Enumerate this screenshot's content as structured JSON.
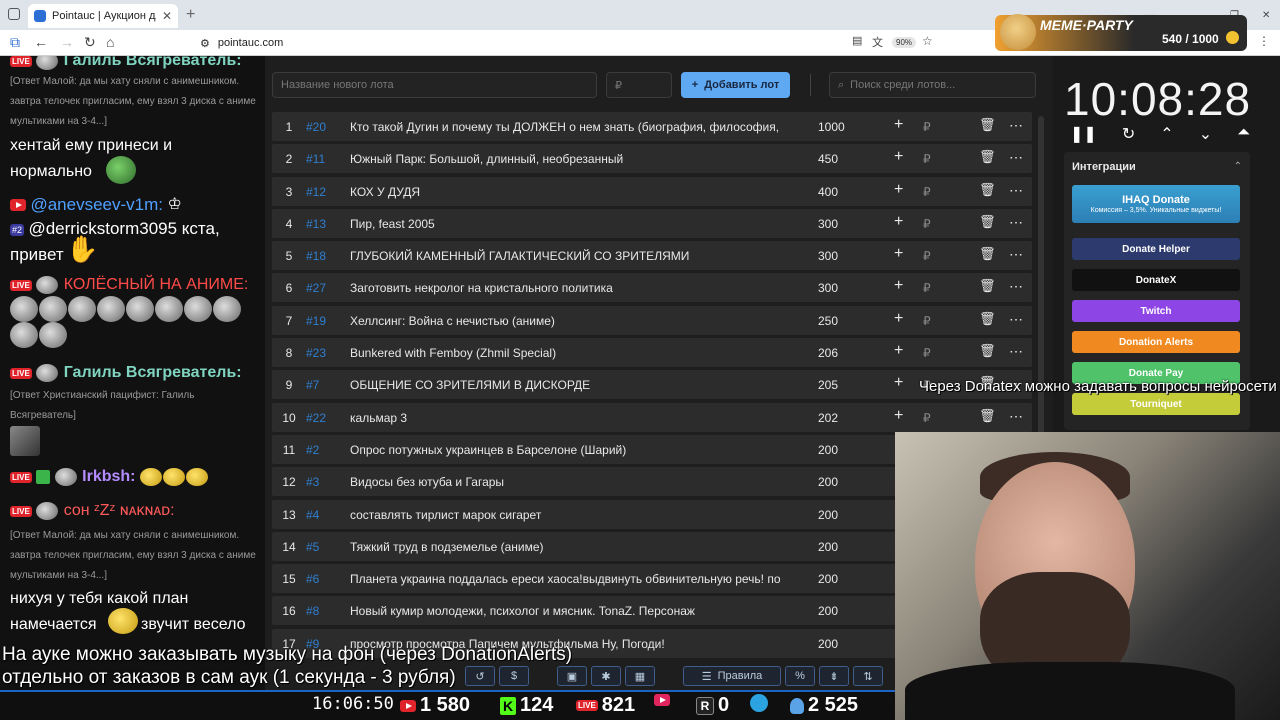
{
  "browser": {
    "tab_title": "Pointauc | Аукцион для стрим…",
    "url": "pointauc.com",
    "zoom": "90%"
  },
  "chat": {
    "messages": [
      {
        "user": "Галиль Всягреватель:",
        "color": "#7fd4c0"
      },
      {
        "quote": "[Ответ Малой: да мы хату сняли с анимешником. завтра телочек пригласим, ему взял 3 диска с аниме мультиками на 3-4...]"
      },
      {
        "text": "хентай ему принеси и нормально"
      },
      {
        "user": "@anevseev-v1m:",
        "color": "#4fa0ff"
      },
      {
        "text": "@derrickstorm3095 кста, привет"
      },
      {
        "user": "КОЛЁСНЫЙ НА АНИМЕ:",
        "color": "#ff4a4a"
      },
      {
        "user2": "Галиль Всягреватель:",
        "color": "#7fd4c0"
      },
      {
        "quote2": "[Ответ Христианский пацифист: Галиль Всягреватель]"
      },
      {
        "user3": "Irkbsh:",
        "color": "#b58cff"
      },
      {
        "user4": "сон ᶻZᶻ ɴᴀᴋɴᴀᴅ:",
        "color": "#ff5a5a"
      },
      {
        "quote3": "[Ответ Малой: да мы хату сняли с анимешником. завтра телочек пригласим, ему взял 3 диска с аниме мультиками на 3-4...]"
      },
      {
        "text2": "нихуя у тебя какой план намечается"
      },
      {
        "text3": "звучит весело"
      }
    ],
    "badge": "#2"
  },
  "auction": {
    "new_lot_placeholder": "Название нового лота",
    "amount_placeholder": "₽",
    "add_button": "Добавить лот",
    "search_placeholder": "Поиск среди лотов...",
    "lots": [
      {
        "num": "1",
        "id": "#20",
        "name": "Кто такой Дугин и почему ты ДОЛЖЕН о нем знать (биография, философия,",
        "amount": "1000"
      },
      {
        "num": "2",
        "id": "#11",
        "name": "Южный Парк: Большой, длинный, необрезанный",
        "amount": "450"
      },
      {
        "num": "3",
        "id": "#12",
        "name": "КОХ У ДУДЯ",
        "amount": "400"
      },
      {
        "num": "4",
        "id": "#13",
        "name": "Пир, feast 2005",
        "amount": "300"
      },
      {
        "num": "5",
        "id": "#18",
        "name": "ГЛУБОКИЙ КАМЕННЫЙ ГАЛАКТИЧЕСКИЙ СО ЗРИТЕЛЯМИ",
        "amount": "300"
      },
      {
        "num": "6",
        "id": "#27",
        "name": "Заготовить некролог на кристального политика",
        "amount": "300"
      },
      {
        "num": "7",
        "id": "#19",
        "name": "Хеллсинг: Война с нечистью (аниме)",
        "amount": "250"
      },
      {
        "num": "8",
        "id": "#23",
        "name": "Bunkered with Femboy (Zhmil Special)",
        "amount": "206"
      },
      {
        "num": "9",
        "id": "#7",
        "name": "ОБЩЕНИЕ СО ЗРИТЕЛЯМИ В ДИСКОРДЕ",
        "amount": "205"
      },
      {
        "num": "10",
        "id": "#22",
        "name": "кальмар 3",
        "amount": "202"
      },
      {
        "num": "11",
        "id": "#2",
        "name": "Опрос потужных украинцев в Барселоне (Шарий)",
        "amount": "200"
      },
      {
        "num": "12",
        "id": "#3",
        "name": "Видосы без ютуба и Гагары",
        "amount": "200"
      },
      {
        "num": "13",
        "id": "#4",
        "name": "составлять тирлист марок сигарет",
        "amount": "200"
      },
      {
        "num": "14",
        "id": "#5",
        "name": "Тяжкий труд в подземелье (аниме)",
        "amount": "200"
      },
      {
        "num": "15",
        "id": "#6",
        "name": "Планета украина поддалась ереси хаоса!выдвинуть обвинительную речь! по",
        "amount": "200"
      },
      {
        "num": "16",
        "id": "#8",
        "name": "Новый кумир молодежи, психолог и мясник. TonaZ. Персонаж",
        "amount": "200"
      },
      {
        "num": "17",
        "id": "#9",
        "name": "просмотр просмотра Папичем мультфильма Ну, Погоди!",
        "amount": "200"
      }
    ],
    "toolbar": {
      "dollar": "$",
      "rules": "Правила",
      "percent": "%"
    }
  },
  "timer": "10:08:28",
  "integrations": {
    "title": "Интеграции",
    "ihaq": "IHAQ Donate",
    "ihaq_sub": "Комиссия – 3,5%. Уникальные виджеты!",
    "items": [
      {
        "label": "Donate Helper",
        "color": "#2c3a6e"
      },
      {
        "label": "DonateX",
        "color": "#111111"
      },
      {
        "label": "Twitch",
        "color": "#8d45e6"
      },
      {
        "label": "Donation Alerts",
        "color": "#f08a20"
      },
      {
        "label": "Donate Pay",
        "color": "#4fc26a"
      },
      {
        "label": "Tourniquet",
        "color": "#c5cc3a"
      }
    ]
  },
  "meme_party": {
    "title": "MEME·PARTY",
    "value": "540 / 1000"
  },
  "overlay": {
    "donatex_note": "Через Donatex можно задавать вопросы нейросети",
    "music_line1": "На ауке можно заказывать музыку на фон (через DonationAlerts)",
    "music_line2": "отдельно от заказов в сам аук (1 секунда - 3 рубля)"
  },
  "stats": {
    "clock": "16:06:50",
    "youtube": "1 580",
    "kick": "124",
    "vk": "821",
    "rutube": "0",
    "total": "2 525"
  }
}
